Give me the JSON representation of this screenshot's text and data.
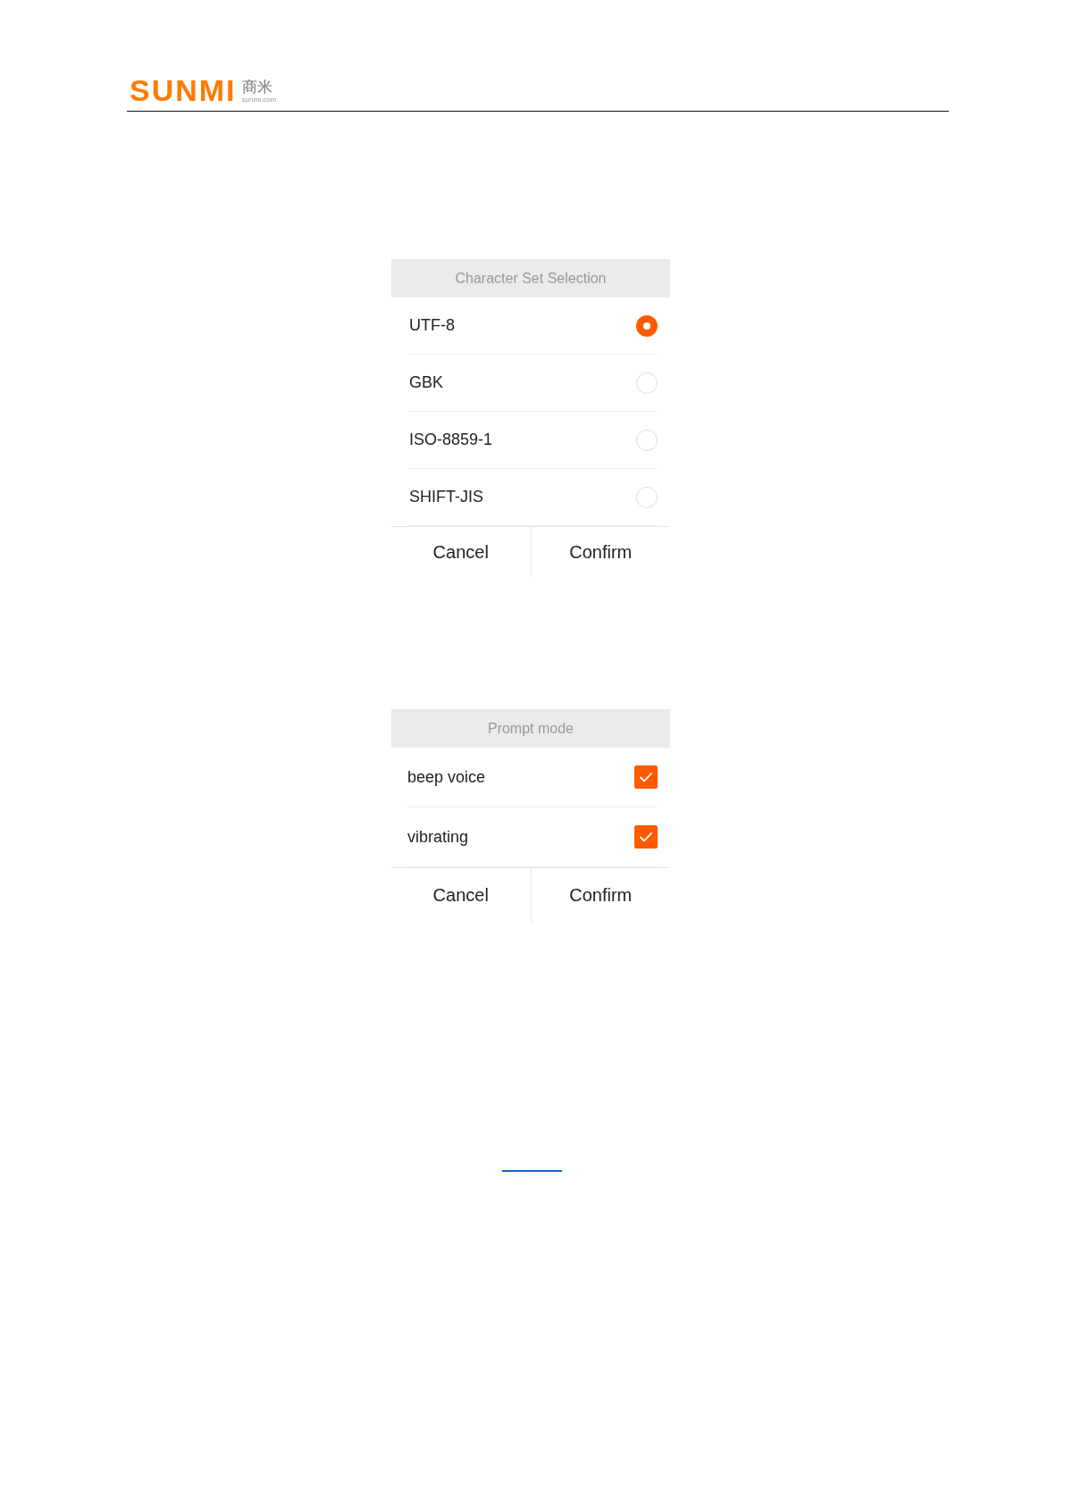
{
  "header": {
    "brand": "SUNMI",
    "brand_chinese": "商米",
    "domain": "sunmi.com"
  },
  "dialogs": [
    {
      "title": "Character Set Selection",
      "kind": "radio",
      "options": [
        {
          "label": "UTF-8",
          "selected": true
        },
        {
          "label": "GBK",
          "selected": false
        },
        {
          "label": "ISO-8859-1",
          "selected": false
        },
        {
          "label": "SHIFT-JIS",
          "selected": false
        }
      ],
      "buttons": [
        "Cancel",
        "Confirm"
      ]
    },
    {
      "title": "Prompt mode",
      "kind": "checkbox",
      "options": [
        {
          "label": "beep voice",
          "checked": true
        },
        {
          "label": "vibrating",
          "checked": true
        }
      ],
      "buttons": [
        "Cancel",
        "Confirm"
      ]
    }
  ]
}
